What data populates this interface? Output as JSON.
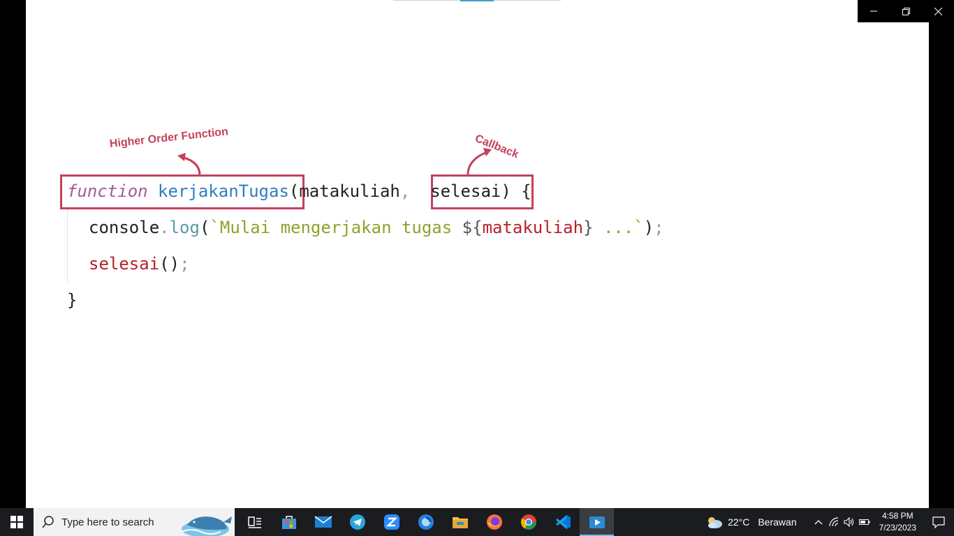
{
  "window": {
    "minimize_icon": "minimize-icon",
    "restore_icon": "restore-icon",
    "close_icon": "close-icon"
  },
  "slide": {
    "annotations": {
      "hof": "Higher Order Function",
      "callback": "Callback"
    },
    "code": {
      "line1": {
        "keyword": "function",
        "fname": "kerjakanTugas",
        "open": "(",
        "param1": "matakuliah",
        "comma": ",",
        "param2": "selesai",
        "close": ")",
        "brace": "{"
      },
      "line2": {
        "obj": "console",
        "dot": ".",
        "method": "log",
        "paren_open": "(",
        "tick": "`",
        "text": "Mulai mengerjakan tugas ",
        "interp_open": "${",
        "interp_var": "matakuliah",
        "interp_close": "}",
        "ellipsis": " ...",
        "tick_close": "`",
        "paren_close": ")",
        "semi": ";"
      },
      "line3": {
        "call": "selesai",
        "parens": "()",
        "semi": ";"
      },
      "line4": {
        "brace": "}"
      }
    }
  },
  "taskbar": {
    "search_placeholder": "Type here to search",
    "apps": [
      "task-view",
      "microsoft-store",
      "mail",
      "telegram",
      "zoom",
      "browser-app",
      "file-explorer",
      "firefox",
      "chrome",
      "vscode",
      "media-player"
    ],
    "weather": {
      "temp": "22°C",
      "condition": "Berawan"
    },
    "clock": {
      "time": "4:58 PM",
      "date": "7/23/2023"
    }
  },
  "colors": {
    "accent": "#c4415b",
    "keyword": "#a25b9a",
    "function": "#2f7fbf",
    "string": "#8aa52a",
    "variable": "#b5222a"
  }
}
